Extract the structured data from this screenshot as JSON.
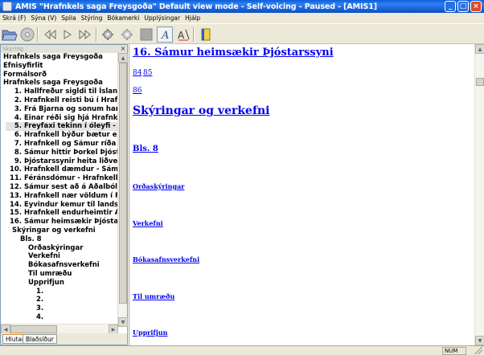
{
  "window": {
    "title": "AMIS \"Hrafnkels saga Freysgoða\" Default view mode - Self-voicing - Paused - [AMIS1]",
    "controls": [
      "_",
      "□",
      "×"
    ]
  },
  "menu": [
    "Skrá (F)",
    "Sýna (V)",
    "Spila",
    "Stýring",
    "Bókamerki",
    "Upplýsingar",
    "Hjálp"
  ],
  "toolbar": {
    "icons": [
      "folder-open-icon",
      "cd-icon",
      "skip-back-icon",
      "play-icon",
      "skip-forward-icon",
      "settings-icon",
      "settings-alt-icon",
      "disabled-square-icon",
      "text-style-icon",
      "font-size-icon",
      "bookmark-icon"
    ]
  },
  "sidebar": {
    "header_label": "Skýring",
    "close_glyph": "×",
    "tree": [
      {
        "num": "",
        "text": "Hrafnkels saga Freysgoða",
        "indent": 0
      },
      {
        "num": "",
        "text": "Efnisyfirlit",
        "indent": 0
      },
      {
        "num": "",
        "text": "Formálsorð",
        "indent": 0
      },
      {
        "num": "",
        "text": "Hrafnkels saga Freysgoða",
        "indent": 0
      },
      {
        "num": "1.",
        "text": "Hallfreður sigldi til Íslands",
        "indent": 1
      },
      {
        "num": "2.",
        "text": "Hrafnkell reisti bú í Hrafnk",
        "indent": 1
      },
      {
        "num": "3.",
        "text": "Frá Bjarna og sonum hans",
        "indent": 1
      },
      {
        "num": "4.",
        "text": "Einar réði sig hjá Hrafnkel",
        "indent": 1
      },
      {
        "num": "5.",
        "text": "Freyfaxi tekinn í óleyfi - H",
        "indent": 1,
        "selected": true
      },
      {
        "num": "6.",
        "text": "Hrafnkell býður bætur en Þ",
        "indent": 1
      },
      {
        "num": "7.",
        "text": "Hrafnkell og Sámur ríða til",
        "indent": 1
      },
      {
        "num": "8.",
        "text": "Sámur hittir Þorkel Þjósta",
        "indent": 1
      },
      {
        "num": "9.",
        "text": "Þjóstarssynir heita liðveis",
        "indent": 1
      },
      {
        "num": "10.",
        "text": "Hrafnkell dæmdur - Sámu",
        "indent": 1
      },
      {
        "num": "11.",
        "text": "Féránsdómur - Hrafnkell",
        "indent": 1
      },
      {
        "num": "12.",
        "text": "Sámur sest að á Aðalbóli",
        "indent": 1
      },
      {
        "num": "13.",
        "text": "Hrafnkell nær völdum í Fl",
        "indent": 1
      },
      {
        "num": "14.",
        "text": "Eyvindur kemur til landsi",
        "indent": 1
      },
      {
        "num": "15.",
        "text": "Hrafnkell endurheimtir Að",
        "indent": 1
      },
      {
        "num": "16.",
        "text": "Sámur heimsækir Þjóstar",
        "indent": 1
      },
      {
        "num": "",
        "text": "Skýringar og verkefni",
        "indent": 2
      },
      {
        "num": "",
        "text": "Bls. 8",
        "indent": 3
      },
      {
        "num": "",
        "text": "Orðaskýringar",
        "indent": 4
      },
      {
        "num": "",
        "text": "Verkefni",
        "indent": 4
      },
      {
        "num": "",
        "text": "Bókasafnsverkefni",
        "indent": 4
      },
      {
        "num": "",
        "text": "Til umræðu",
        "indent": 4
      },
      {
        "num": "",
        "text": "Upprifjun",
        "indent": 4
      },
      {
        "num": "1.",
        "text": "",
        "indent": 5
      },
      {
        "num": "2.",
        "text": "",
        "indent": 5
      },
      {
        "num": "3.",
        "text": "",
        "indent": 5
      },
      {
        "num": "4.",
        "text": "",
        "indent": 5
      }
    ],
    "tabs": [
      "Hlutar",
      "Blaðsíður"
    ]
  },
  "content": {
    "heading": "16. Sámur heimsækir Þjóstarssyni",
    "page_link_1": "84",
    "page_link_2": "85",
    "page_link_3": "86",
    "section_heading": "Skýringar og verkefni",
    "page_label": "Bls. 8",
    "links": [
      "Orðaskýringar",
      "Verkefni",
      "Bókasafnsverkefni",
      "Til umræðu",
      "Upprifjun"
    ]
  },
  "status": {
    "num_indicator": "NUM"
  },
  "colors": {
    "title_bar": "#0a5fd8",
    "link": "#0000ee",
    "chrome": "#ece9d8"
  }
}
